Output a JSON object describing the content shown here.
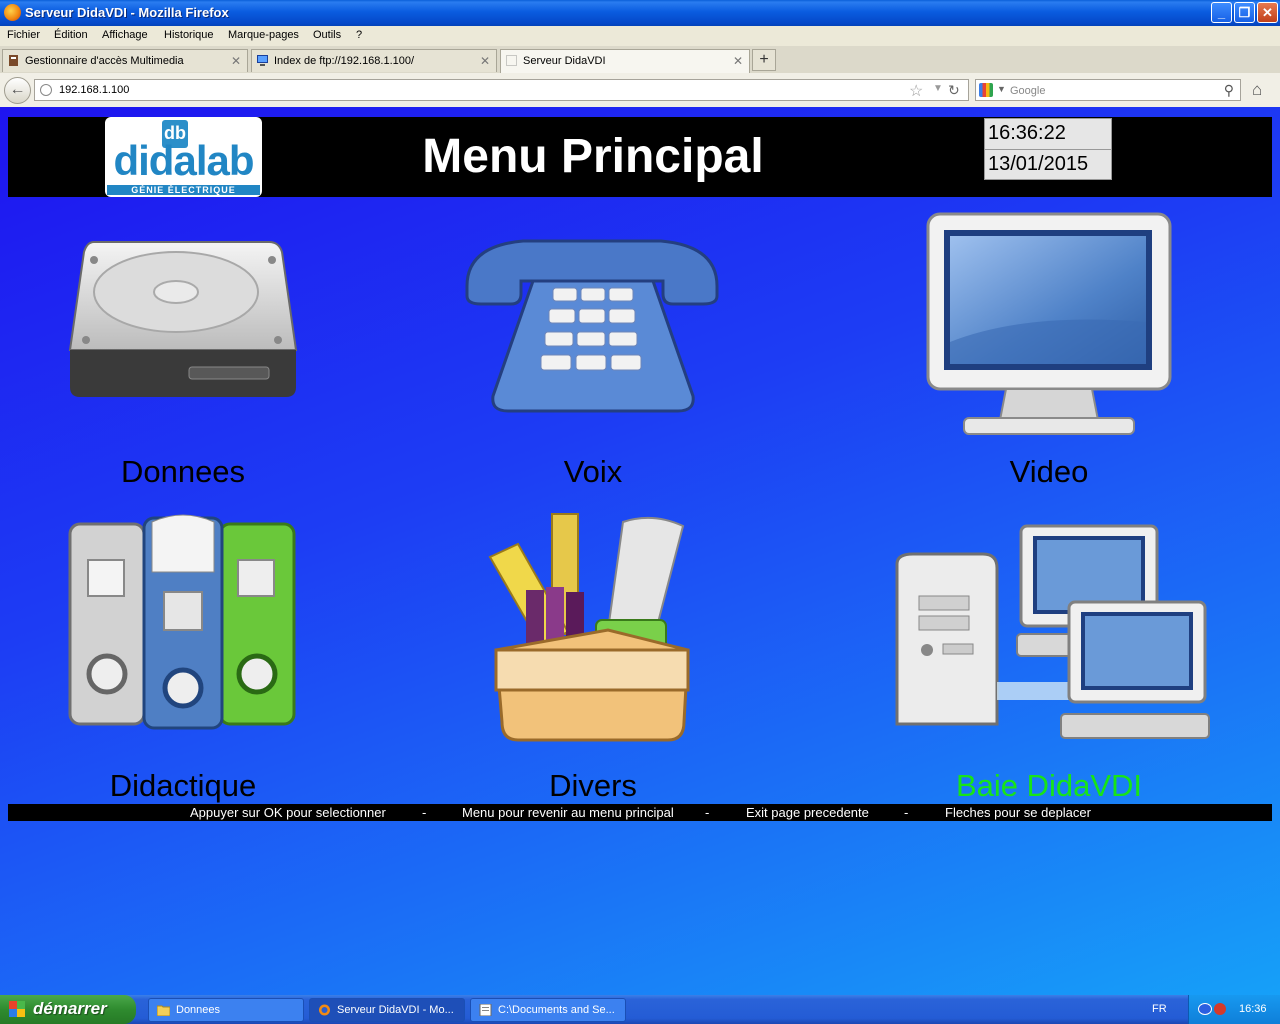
{
  "window": {
    "title": "Serveur DidaVDI - Mozilla Firefox",
    "buttons": {
      "minimize": "_",
      "maximize": "❐",
      "close": "✕"
    }
  },
  "menubar": [
    "Fichier",
    "Édition",
    "Affichage",
    "Historique",
    "Marque-pages",
    "Outils",
    "?"
  ],
  "tabs": [
    {
      "label": "Gestionnaire d'accès Multimedia",
      "active": false
    },
    {
      "label": "Index de ftp://192.168.1.100/",
      "active": false
    },
    {
      "label": "Serveur DidaVDI",
      "active": true
    }
  ],
  "newtab_label": "+",
  "navbar": {
    "url": "192.168.1.100",
    "search_placeholder": "Google"
  },
  "page": {
    "logo": {
      "badge": "db",
      "brand": "didalab",
      "subtitle": "GÉNIE ÉLECTRIQUE"
    },
    "title": "Menu Principal",
    "time": "16:36:22",
    "date": "13/01/2015",
    "items": [
      {
        "label": "Donnees",
        "icon": "hard-drive-icon",
        "selected": false
      },
      {
        "label": "Voix",
        "icon": "telephone-icon",
        "selected": false
      },
      {
        "label": "Video",
        "icon": "monitor-icon",
        "selected": false
      },
      {
        "label": "Didactique",
        "icon": "binders-icon",
        "selected": false
      },
      {
        "label": "Divers",
        "icon": "box-of-supplies-icon",
        "selected": false
      },
      {
        "label": "Baie DidaVDI",
        "icon": "network-computers-icon",
        "selected": true
      }
    ],
    "selected_color": "#18e418",
    "footer": [
      "Appuyer sur OK pour selectionner",
      "-",
      "Menu pour revenir au menu principal",
      "-",
      "Exit page precedente",
      "-",
      "Fleches pour se deplacer"
    ]
  },
  "taskbar": {
    "start_label": "démarrer",
    "tasks": [
      {
        "label": "Donnees",
        "icon": "folder-icon",
        "active": false
      },
      {
        "label": "Serveur DidaVDI - Mo...",
        "icon": "firefox-icon",
        "active": true
      },
      {
        "label": "C:\\Documents and Se...",
        "icon": "notepad-icon",
        "active": false
      }
    ],
    "language": "FR",
    "clock": "16:36"
  }
}
